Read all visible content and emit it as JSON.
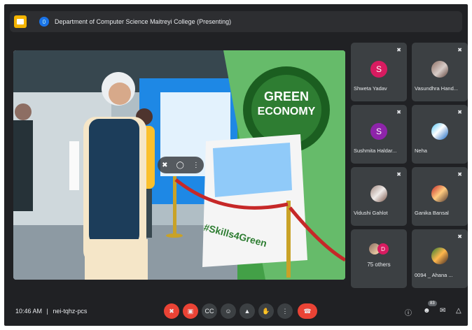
{
  "topbar": {
    "presenter_badge": "0",
    "title": "Department of Computer Science Maitreyi College (Presenting)"
  },
  "main_video": {
    "banner_text": "GREEN ECONOMY",
    "sign_text": "#Skills4Green"
  },
  "participants": [
    {
      "name": "Shweta Yadav",
      "initial": "S",
      "color": "#d81b60",
      "kind": "letter"
    },
    {
      "name": "Vasundhra Hand...",
      "kind": "photo",
      "photo_icon": "profile-photo-icon"
    },
    {
      "name": "Sushmita Haldar...",
      "initial": "S",
      "color": "#8e24aa",
      "kind": "letter"
    },
    {
      "name": "Neha",
      "kind": "photo",
      "photo_icon": "profile-photo-icon"
    },
    {
      "name": "Vidushi Gahlot",
      "kind": "photo",
      "photo_icon": "profile-photo-icon"
    },
    {
      "name": "Ganika Bansal",
      "kind": "photo",
      "photo_icon": "profile-photo-icon"
    },
    {
      "name": "75 others",
      "kind": "group",
      "initial": "D"
    },
    {
      "name": "0094 _ Ahana ...",
      "kind": "photo",
      "photo_icon": "profile-photo-icon"
    }
  ],
  "bottombar": {
    "time": "10:46 AM",
    "separator": "|",
    "meeting_code": "nei-tqhz-pcs",
    "people_count": "83",
    "controls": [
      "mic-off-icon",
      "camera-off-icon",
      "captions-icon",
      "emoji-icon",
      "present-icon",
      "raise-hand-icon",
      "more-options-icon",
      "end-call-icon"
    ],
    "right_icons": [
      "info-icon",
      "people-icon",
      "chat-icon",
      "activities-icon"
    ]
  },
  "colors": {
    "background": "#202124",
    "tile": "#3c4043",
    "danger": "#ea4335",
    "accent": "#1a73e8"
  }
}
